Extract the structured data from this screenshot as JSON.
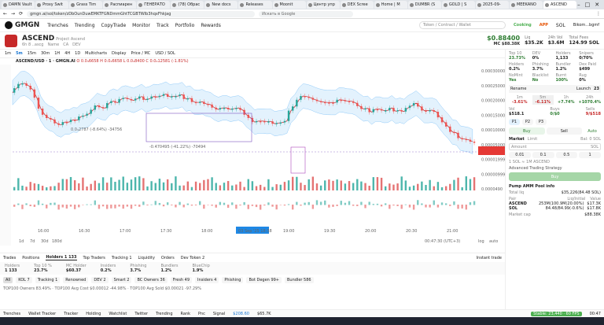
{
  "browser": {
    "tabs": [
      "DAMN Vault",
      "Proxy Swit",
      "Grass Tim",
      "Распиарен",
      "ГЕНЕРАТО",
      "(78) Обрас",
      "New docs",
      "Releases",
      "Moonit",
      "Центр упр",
      "DEX Scree",
      "Home | M",
      "DUMBR (S",
      "GOLD | S",
      "2025-09-",
      "MEEKANO",
      "ASCEND"
    ],
    "url": "gmgn.ai/sol/token/zDbOunDuwEMKTFGNDmmGhtTCGBTWIb3hqxFhkjag",
    "search": "Искать в Google"
  },
  "app": {
    "brand": "GMGN",
    "nav": [
      "Trenches",
      "Trending",
      "CopyTrade",
      "Monitor",
      "Track",
      "Portfolio",
      "Rewards"
    ],
    "search_placeholder": "Token / Contract / Wallet",
    "cooking": "Cooking",
    "app": "APP",
    "chain": "SOL",
    "user": "Bikom...bgmf"
  },
  "token": {
    "name": "ASCEND",
    "sub": "Project Ascend",
    "age": "6h 8 ..ascg",
    "links": [
      "Name",
      "CA",
      "DEV"
    ],
    "price": "$0.88400",
    "price_sub": "MC $88.38K",
    "liq_label": "Liq",
    "liq": "$35.2K",
    "vol_label": "24h Vol",
    "vol": "$3.6M",
    "supply_label": "Total Fees",
    "supply": "124.99 SOL"
  },
  "chart": {
    "title": "ASCEND/USD · 1 · GMGN.AI",
    "ohlc": "O 0.0₄6658 H 0.0₄6658 L 0.0₄8400 C 0.0₄12581 (-1.81%)",
    "tools": [
      "1m",
      "5m",
      "15m",
      "30m",
      "1H",
      "4H",
      "1D",
      "Multicharts",
      "Display",
      "Price / MC",
      "USD / SOL"
    ],
    "xlabels": [
      "16:00",
      "16:30",
      "17:00",
      "17:30",
      "18:00",
      "18:30",
      "19:00",
      "19:30",
      "20:00",
      "20:30",
      "21:00"
    ],
    "cursor_date": "03 Sep '25",
    "cursor_time": "18:38",
    "ylabels": [
      "0.00030000",
      "0.00025000",
      "0.00020000",
      "0.00015000",
      "0.00010000",
      "0.00005000",
      "0.00001999",
      "0.00000999",
      "0.0000490"
    ],
    "annotation": "-0.470495 (-41.22%) -70494",
    "annotation2": "0.0₄2787 (-8.64%) -34756",
    "periods": [
      "1d",
      "7d",
      "30d",
      "180d"
    ],
    "clock": "00:47:30 (UTC+3)",
    "mode": "log",
    "mode2": "auto"
  },
  "right": {
    "stats": [
      {
        "l": "Top 10",
        "v": "23.73%"
      },
      {
        "l": "DEV",
        "v": "0%"
      },
      {
        "l": "Holders",
        "v": "1,133"
      },
      {
        "l": "Snipers",
        "v": "0/70%"
      },
      {
        "l": "Holders",
        "v": "0.2%"
      },
      {
        "l": "Phishing",
        "v": "3.7%"
      },
      {
        "l": "Bundler",
        "v": "1.2%"
      },
      {
        "l": "Dex Paid",
        "v": "$499"
      },
      {
        "l": "NoMint",
        "v": "Yes"
      },
      {
        "l": "Blacklist",
        "v": "No"
      },
      {
        "l": "Burnt",
        "v": "100%"
      },
      {
        "l": "Rug",
        "v": "0%"
      }
    ],
    "rename": "Rename",
    "launch": "Launch",
    "launch_v": "23",
    "periods": [
      {
        "l": "1m",
        "v": "-3.61%"
      },
      {
        "l": "5m",
        "v": "-6.11%"
      },
      {
        "l": "1h",
        "v": "+7.74%"
      },
      {
        "l": "24h",
        "v": "+1070.4%"
      }
    ],
    "vol": {
      "l": "Vol",
      "v": "$518.1"
    },
    "buys": {
      "l": "Buys",
      "v": "0/$0"
    },
    "sells": {
      "l": "Sells",
      "v": "9/$518"
    },
    "presets": [
      "P1",
      "P2",
      "P3"
    ],
    "buy": "Buy",
    "sell": "Sell",
    "auto": "Auto",
    "market": "Market",
    "limit": "Limit",
    "bal": "Bal: 0 SOL",
    "amount": "Amount",
    "amt_opts": [
      "0.01",
      "0.1",
      "0.5",
      "1"
    ],
    "rate": "1 SOL ≈ 1M ASCEND",
    "adv": "Advanced Trading Strategy",
    "buy_btn": "Buy",
    "pool_title": "Pump AMM Pool info",
    "total_liq": "Total liq",
    "total_liq_v": "$35,226(84.48 SOL)",
    "pair": "Pair",
    "liq_init": "Liq/Initial",
    "value": "Value",
    "p1": "ASCEND",
    "p1v": "253M(100.9M(20.00%)",
    "p1val": "$17.3K",
    "p2": "SOL",
    "p2v": "84.48/84.99(-0.6%)",
    "p2val": "$17.8K",
    "mcap": "Market cap",
    "mcap_v": "$88.38K"
  },
  "bottom": {
    "tabs": [
      "Trades",
      "Positions",
      "Holders 1 133",
      "Top Traders",
      "Tracking 1",
      "Liquidity",
      "Orders",
      "Dev Token 2"
    ],
    "instant": "Instant trade",
    "cols": [
      {
        "l": "Holders",
        "v": "1 133"
      },
      {
        "l": "Top 10 %",
        "v": "23.7%"
      },
      {
        "l": "MC Holder",
        "v": "$60.37"
      },
      {
        "l": "Insiders",
        "v": "0.2%"
      },
      {
        "l": "Phishing",
        "v": "3.7%"
      },
      {
        "l": "Bundlers",
        "v": "1.2%"
      },
      {
        "l": "BlueChip",
        "v": "1.9%"
      }
    ],
    "filters": [
      "All",
      "KOL 7",
      "Tracking 1",
      "Renowned",
      "DEV 2",
      "Smart 2",
      "BC Owners 36",
      "Fresh 49",
      "Insiders 4",
      "Phishing",
      "Bot Degen 99+",
      "Bundler 586"
    ],
    "summary": "TOP100 Owners 83.49% · TOP100 Avg Cost $0.00012 -44.98% · TOP100 Avg Sold $0.00021 -97.29%"
  },
  "status": {
    "items": [
      "Trenches",
      "Wallet Tracker",
      "Tracker",
      "Holding",
      "Watchlist",
      "Twitter",
      "Trending",
      "Rank",
      "Pnc",
      "Signal"
    ],
    "sol_price": "$208.60",
    "eth_price": "$65.7K",
    "stable": "Stable: 23,440 · 60 FPS",
    "clock": "00:47"
  }
}
